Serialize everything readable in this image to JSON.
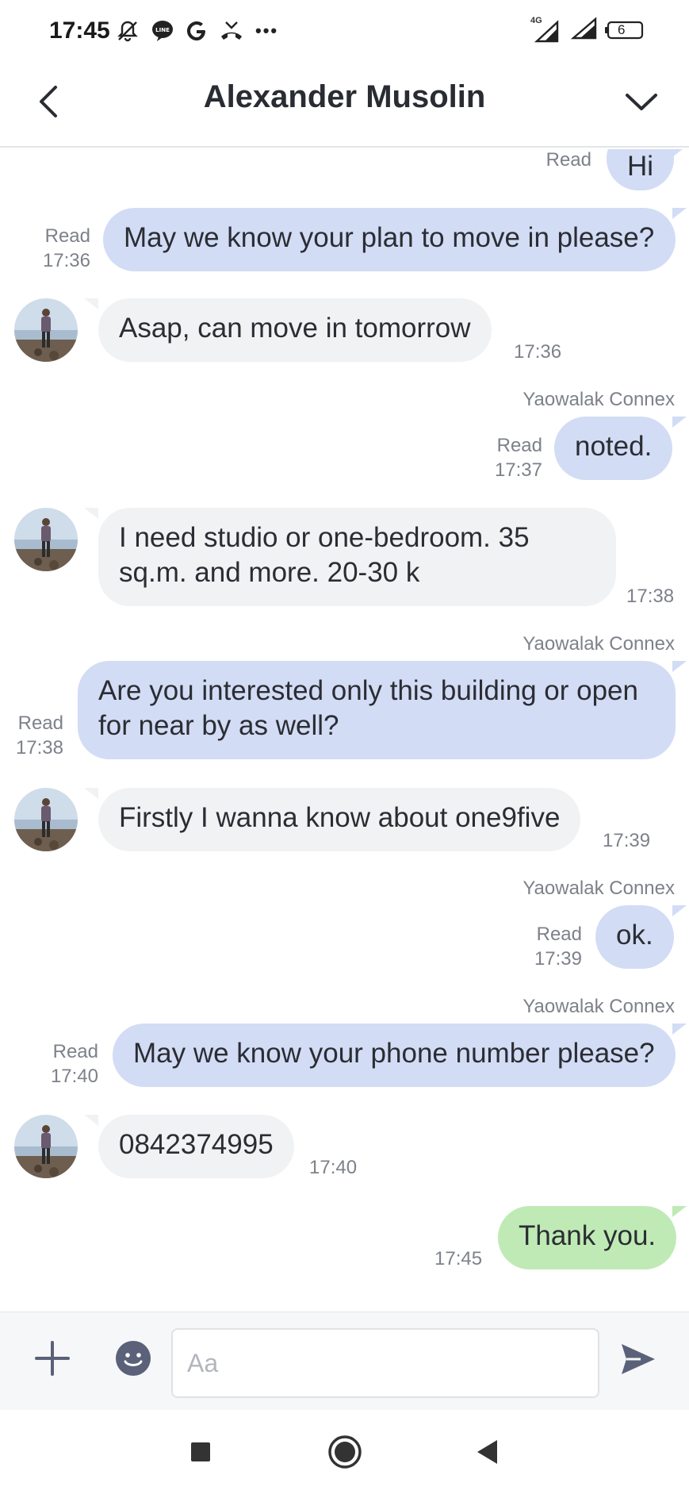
{
  "status_bar": {
    "time": "17:45",
    "network": "4G",
    "battery": "6",
    "more": "•••"
  },
  "header": {
    "title": "Alexander Musolin"
  },
  "messages": [
    {
      "id": "m1",
      "dir": "out",
      "text": "Hi",
      "read": "Read",
      "time": ""
    },
    {
      "id": "m2",
      "dir": "out",
      "text": "May we know your plan to move in please?",
      "read": "Read",
      "time": "17:36"
    },
    {
      "id": "m3",
      "dir": "in",
      "text": "Asap, can move in tomorrow",
      "time": "17:36"
    },
    {
      "id": "m4",
      "dir": "out",
      "sender": "Yaowalak Connex",
      "text": "noted.",
      "read": "Read",
      "time": "17:37"
    },
    {
      "id": "m5",
      "dir": "in",
      "text": "I need studio or one-bedroom. 35\nsq.m. and more. 20-30 k",
      "time": "17:38"
    },
    {
      "id": "m6",
      "dir": "out",
      "sender": "Yaowalak Connex",
      "text": "Are you interested only this building or open\nfor near by as well?",
      "read": "Read",
      "time": "17:38"
    },
    {
      "id": "m7",
      "dir": "in",
      "text": "Firstly I wanna know about one9five",
      "time": "17:39"
    },
    {
      "id": "m8",
      "dir": "out",
      "sender": "Yaowalak Connex",
      "text": "ok.",
      "read": "Read",
      "time": "17:39"
    },
    {
      "id": "m9",
      "dir": "out",
      "sender": "Yaowalak Connex",
      "text": "May we know your phone number please?",
      "read": "Read",
      "time": "17:40"
    },
    {
      "id": "m10",
      "dir": "in",
      "text": "0842374995",
      "time": "17:40"
    },
    {
      "id": "m11",
      "dir": "out",
      "text": "Thank you.",
      "read": "",
      "time": "17:45"
    }
  ],
  "input": {
    "placeholder": "Aa"
  },
  "colors": {
    "outgoing_bubble": "#d2dcf5",
    "incoming_bubble": "#f1f2f4",
    "unsent_bubble": "#bfeab5",
    "icon": "#5a6178"
  }
}
